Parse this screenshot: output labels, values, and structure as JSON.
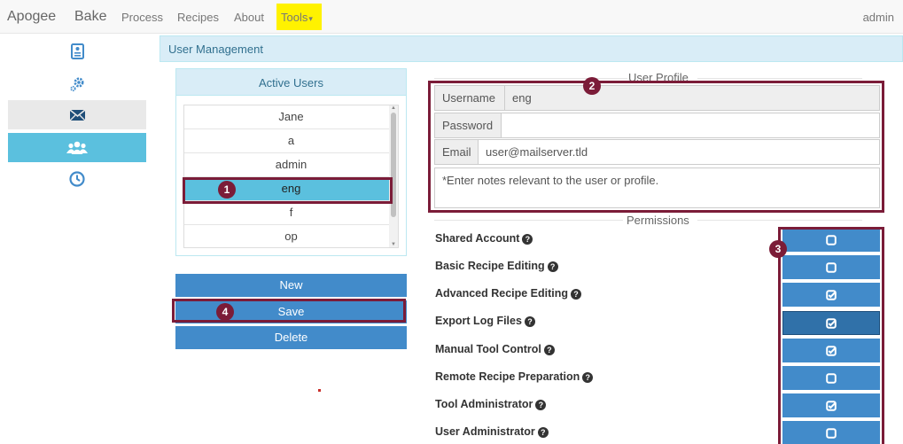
{
  "nav": {
    "brand_1": "Apogee",
    "brand_2": "Bake",
    "links": [
      "Process",
      "Recipes",
      "About"
    ],
    "tools_label": "Tools",
    "tools_caret": "▾",
    "user": "admin"
  },
  "sidebar": {
    "items": [
      {
        "icon": "id-card-icon"
      },
      {
        "icon": "cogs-icon"
      },
      {
        "icon": "envelope-icon"
      },
      {
        "icon": "users-icon",
        "active": true
      },
      {
        "icon": "clock-icon"
      }
    ]
  },
  "panel_title": "User Management",
  "active_users": {
    "title": "Active Users",
    "users": [
      "Jane",
      "a",
      "admin",
      "eng",
      "f",
      "op"
    ],
    "selected": "eng"
  },
  "buttons": {
    "new": "New",
    "save": "Save",
    "delete": "Delete"
  },
  "profile": {
    "legend": "User Profile",
    "username_label": "Username",
    "username_value": "eng",
    "password_label": "Password",
    "email_label": "Email",
    "email_value": "user@mailserver.tld",
    "notes_placeholder": "*Enter notes relevant to the user or profile."
  },
  "permissions": {
    "legend": "Permissions",
    "items": [
      {
        "label": "Shared Account",
        "checked": false
      },
      {
        "label": "Basic Recipe Editing",
        "checked": false
      },
      {
        "label": "Advanced Recipe Editing",
        "checked": true
      },
      {
        "label": "Export Log Files",
        "checked": true
      },
      {
        "label": "Manual Tool Control",
        "checked": true
      },
      {
        "label": "Remote Recipe Preparation",
        "checked": false
      },
      {
        "label": "Tool Administrator",
        "checked": true
      },
      {
        "label": "User Administrator",
        "checked": false
      }
    ]
  },
  "annotations": [
    "1",
    "2",
    "3",
    "4"
  ],
  "colors": {
    "accent": "#428bca",
    "selected": "#5bc0de",
    "annotation": "#7b1c38",
    "highlight": "#fff200"
  }
}
